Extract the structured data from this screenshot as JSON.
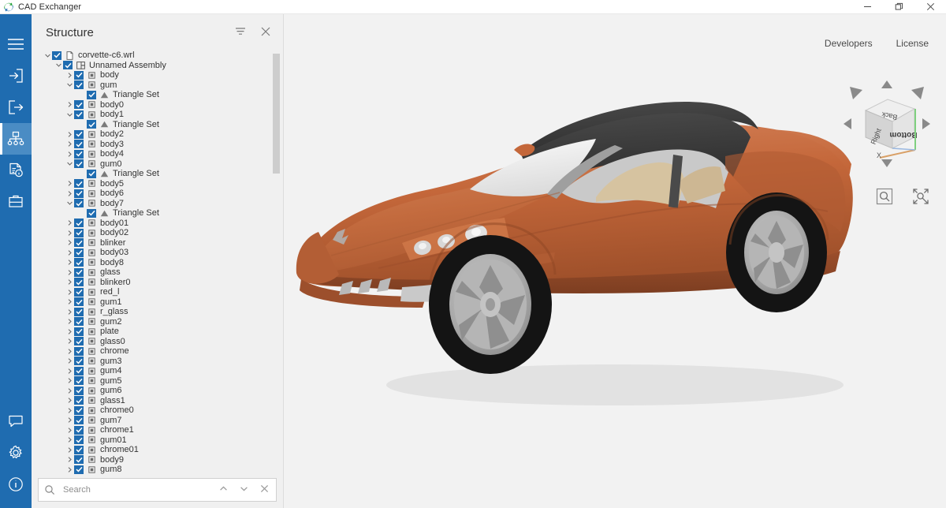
{
  "window": {
    "app_title": "CAD Exchanger",
    "logo_icon": "cad-exchanger-logo",
    "controls": [
      {
        "name": "minimize",
        "icon": "minimize-icon"
      },
      {
        "name": "restore",
        "icon": "restore-icon"
      },
      {
        "name": "close",
        "icon": "close-icon"
      }
    ]
  },
  "rail": {
    "top_items": [
      {
        "name": "menu",
        "icon": "hamburger-menu-icon",
        "active": false
      },
      {
        "name": "import",
        "icon": "import-icon",
        "active": false
      },
      {
        "name": "export",
        "icon": "export-icon",
        "active": false
      },
      {
        "name": "structure",
        "icon": "structure-tree-icon",
        "active": true
      },
      {
        "name": "properties",
        "icon": "document-info-icon",
        "active": false
      },
      {
        "name": "toolbox",
        "icon": "toolbox-icon",
        "active": false
      }
    ],
    "bottom_items": [
      {
        "name": "feedback",
        "icon": "chat-bubble-icon",
        "active": false
      },
      {
        "name": "settings",
        "icon": "gear-icon",
        "active": false
      },
      {
        "name": "about",
        "icon": "info-circle-icon",
        "active": false
      }
    ]
  },
  "panel": {
    "title": "Structure",
    "filter_icon": "filter-icon",
    "close_icon": "close-icon",
    "tree": [
      {
        "label": "corvette-c6.wrl",
        "depth": 0,
        "expander": "down",
        "checked": true,
        "icon": "file-icon"
      },
      {
        "label": "Unnamed Assembly",
        "depth": 1,
        "expander": "down",
        "checked": true,
        "icon": "assembly-icon"
      },
      {
        "label": "body",
        "depth": 2,
        "expander": "right",
        "checked": true,
        "icon": "part-icon"
      },
      {
        "label": "gum",
        "depth": 2,
        "expander": "down",
        "checked": true,
        "icon": "part-icon"
      },
      {
        "label": "Triangle Set",
        "depth": 3,
        "expander": "none",
        "checked": true,
        "icon": "triangle-set-icon"
      },
      {
        "label": "body0",
        "depth": 2,
        "expander": "right",
        "checked": true,
        "icon": "part-icon"
      },
      {
        "label": "body1",
        "depth": 2,
        "expander": "down",
        "checked": true,
        "icon": "part-icon"
      },
      {
        "label": "Triangle Set",
        "depth": 3,
        "expander": "none",
        "checked": true,
        "icon": "triangle-set-icon"
      },
      {
        "label": "body2",
        "depth": 2,
        "expander": "right",
        "checked": true,
        "icon": "part-icon"
      },
      {
        "label": "body3",
        "depth": 2,
        "expander": "right",
        "checked": true,
        "icon": "part-icon"
      },
      {
        "label": "body4",
        "depth": 2,
        "expander": "right",
        "checked": true,
        "icon": "part-icon"
      },
      {
        "label": "gum0",
        "depth": 2,
        "expander": "down",
        "checked": true,
        "icon": "part-icon"
      },
      {
        "label": "Triangle Set",
        "depth": 3,
        "expander": "none",
        "checked": true,
        "icon": "triangle-set-icon"
      },
      {
        "label": "body5",
        "depth": 2,
        "expander": "right",
        "checked": true,
        "icon": "part-icon"
      },
      {
        "label": "body6",
        "depth": 2,
        "expander": "right",
        "checked": true,
        "icon": "part-icon"
      },
      {
        "label": "body7",
        "depth": 2,
        "expander": "down",
        "checked": true,
        "icon": "part-icon"
      },
      {
        "label": "Triangle Set",
        "depth": 3,
        "expander": "none",
        "checked": true,
        "icon": "triangle-set-icon"
      },
      {
        "label": "body01",
        "depth": 2,
        "expander": "right",
        "checked": true,
        "icon": "part-icon"
      },
      {
        "label": "body02",
        "depth": 2,
        "expander": "right",
        "checked": true,
        "icon": "part-icon"
      },
      {
        "label": "blinker",
        "depth": 2,
        "expander": "right",
        "checked": true,
        "icon": "part-icon"
      },
      {
        "label": "body03",
        "depth": 2,
        "expander": "right",
        "checked": true,
        "icon": "part-icon"
      },
      {
        "label": "body8",
        "depth": 2,
        "expander": "right",
        "checked": true,
        "icon": "part-icon"
      },
      {
        "label": "glass",
        "depth": 2,
        "expander": "right",
        "checked": true,
        "icon": "part-icon"
      },
      {
        "label": "blinker0",
        "depth": 2,
        "expander": "right",
        "checked": true,
        "icon": "part-icon"
      },
      {
        "label": "red_l",
        "depth": 2,
        "expander": "right",
        "checked": true,
        "icon": "part-icon"
      },
      {
        "label": "gum1",
        "depth": 2,
        "expander": "right",
        "checked": true,
        "icon": "part-icon"
      },
      {
        "label": "r_glass",
        "depth": 2,
        "expander": "right",
        "checked": true,
        "icon": "part-icon"
      },
      {
        "label": "gum2",
        "depth": 2,
        "expander": "right",
        "checked": true,
        "icon": "part-icon"
      },
      {
        "label": "plate",
        "depth": 2,
        "expander": "right",
        "checked": true,
        "icon": "part-icon"
      },
      {
        "label": "glass0",
        "depth": 2,
        "expander": "right",
        "checked": true,
        "icon": "part-icon"
      },
      {
        "label": "chrome",
        "depth": 2,
        "expander": "right",
        "checked": true,
        "icon": "part-icon"
      },
      {
        "label": "gum3",
        "depth": 2,
        "expander": "right",
        "checked": true,
        "icon": "part-icon"
      },
      {
        "label": "gum4",
        "depth": 2,
        "expander": "right",
        "checked": true,
        "icon": "part-icon"
      },
      {
        "label": "gum5",
        "depth": 2,
        "expander": "right",
        "checked": true,
        "icon": "part-icon"
      },
      {
        "label": "gum6",
        "depth": 2,
        "expander": "right",
        "checked": true,
        "icon": "part-icon"
      },
      {
        "label": "glass1",
        "depth": 2,
        "expander": "right",
        "checked": true,
        "icon": "part-icon"
      },
      {
        "label": "chrome0",
        "depth": 2,
        "expander": "right",
        "checked": true,
        "icon": "part-icon"
      },
      {
        "label": "gum7",
        "depth": 2,
        "expander": "right",
        "checked": true,
        "icon": "part-icon"
      },
      {
        "label": "chrome1",
        "depth": 2,
        "expander": "right",
        "checked": true,
        "icon": "part-icon"
      },
      {
        "label": "gum01",
        "depth": 2,
        "expander": "right",
        "checked": true,
        "icon": "part-icon"
      },
      {
        "label": "chrome01",
        "depth": 2,
        "expander": "right",
        "checked": true,
        "icon": "part-icon"
      },
      {
        "label": "body9",
        "depth": 2,
        "expander": "right",
        "checked": true,
        "icon": "part-icon"
      },
      {
        "label": "gum8",
        "depth": 2,
        "expander": "right",
        "checked": true,
        "icon": "part-icon"
      }
    ]
  },
  "search": {
    "placeholder": "Search",
    "value": "",
    "icon": "search-icon",
    "prev_icon": "chevron-up-icon",
    "next_icon": "chevron-down-icon",
    "close_icon": "close-icon"
  },
  "viewport": {
    "links": [
      {
        "name": "developers",
        "label": "Developers"
      },
      {
        "name": "license",
        "label": "License"
      }
    ],
    "nav_cube": {
      "faces": {
        "top": "Back",
        "left": "Right",
        "front": "Bottom"
      },
      "axis_label": "X",
      "arrows": [
        "up",
        "down",
        "left",
        "right",
        "up-left",
        "up-right"
      ]
    },
    "tools": [
      {
        "name": "zoom-window",
        "icon": "zoom-window-icon"
      },
      {
        "name": "fit-all",
        "icon": "fit-all-icon"
      }
    ],
    "model": {
      "name": "corvette-c6",
      "body_color": "#c4673a",
      "body_shadow": "#9c4f2c",
      "body_highlight": "#d8815a",
      "roof_color": "#3c3c3c",
      "glass_color": "#e8e8e8",
      "interior_color": "#d6c3a0",
      "tire_color": "#141414",
      "wheel_color": "#a9a9a9",
      "background": "#f2f2f2"
    }
  }
}
